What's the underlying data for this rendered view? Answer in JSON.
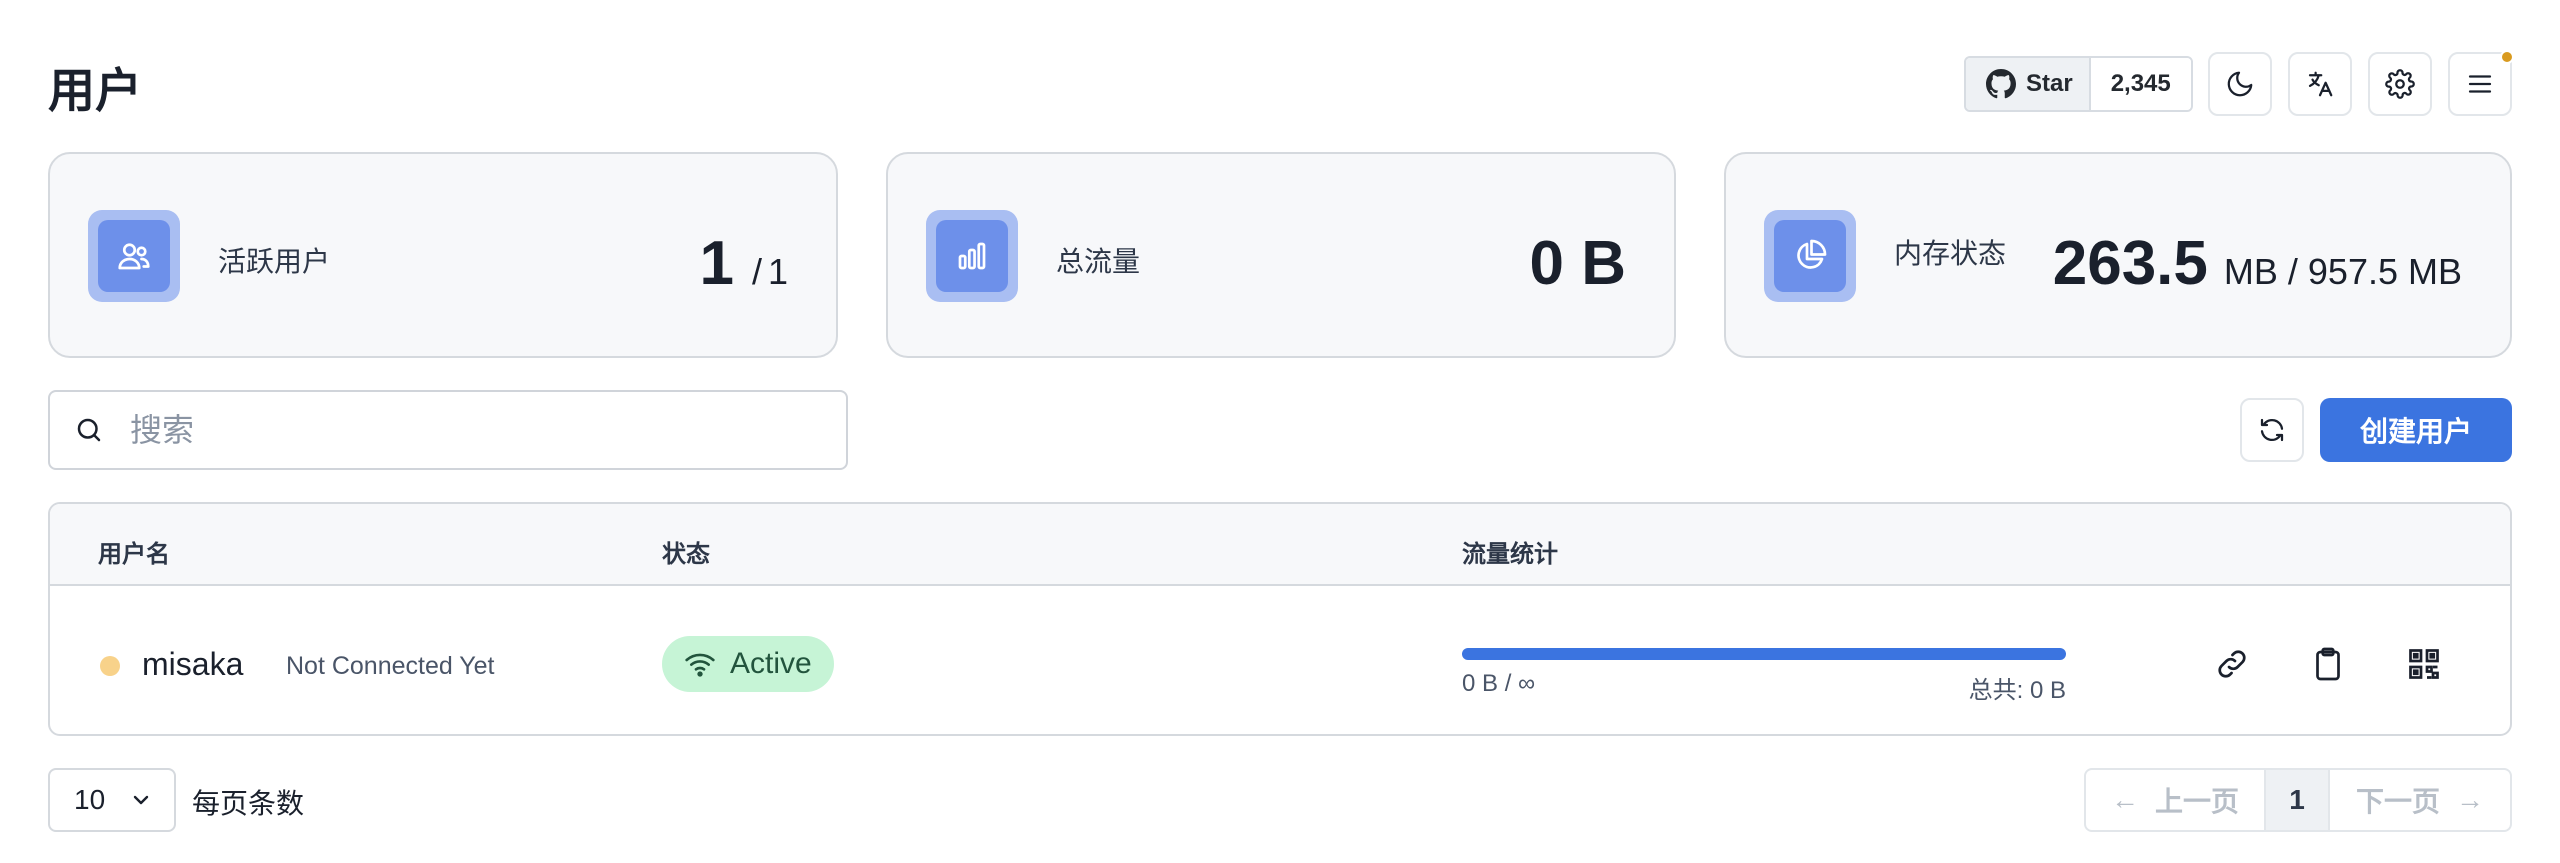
{
  "page": {
    "title": "用户"
  },
  "header": {
    "github": {
      "star_label": "Star",
      "count": "2,345"
    },
    "icons": [
      "moon-icon",
      "translate-icon",
      "gear-icon",
      "menu-icon"
    ]
  },
  "stats": [
    {
      "label": "活跃用户",
      "value": "1",
      "separator": "/",
      "sub": "1",
      "icon": "users-icon"
    },
    {
      "label": "总流量",
      "value": "0 B",
      "icon": "bar-chart-icon"
    },
    {
      "label": "内存状态",
      "value": "263.5",
      "sub": "MB / 957.5 MB",
      "icon": "pie-chart-icon"
    }
  ],
  "search": {
    "placeholder": "搜索"
  },
  "actions": {
    "create_label": "创建用户"
  },
  "table": {
    "headers": [
      "用户名",
      "状态",
      "流量统计"
    ],
    "rows": [
      {
        "username": "misaka",
        "connection": "Not Connected Yet",
        "status": "Active",
        "traffic_used": "0 B / ∞",
        "traffic_total": "总共: 0 B",
        "usage_fraction": 1.0
      }
    ]
  },
  "pagination": {
    "per_page": "10",
    "per_page_label": "每页条数",
    "prev_label": "上一页",
    "current": "1",
    "next_label": "下一页",
    "prev_arrow": "←",
    "next_arrow": "→"
  },
  "colors": {
    "accent": "#3b74e0",
    "active_badge": "#c6f4d6",
    "status_dot": "#f8d28a",
    "notify_dot": "#d99a1f"
  }
}
